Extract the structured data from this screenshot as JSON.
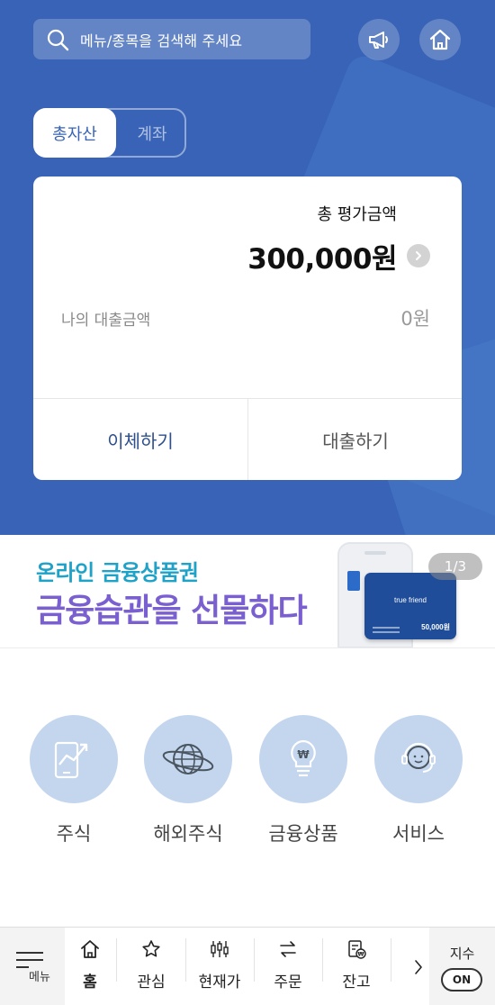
{
  "header": {
    "search": {
      "placeholder": "메뉴/종목을 검색해 주세요"
    },
    "segments": {
      "active": "총자산",
      "inactive": "계좌"
    }
  },
  "summary_card": {
    "total_label": "총 평가금액",
    "total_amount": "300,000원",
    "loan_label": "나의 대출금액",
    "loan_amount": "0원",
    "actions": {
      "transfer": "이체하기",
      "loan": "대출하기"
    }
  },
  "banner": {
    "line1": "온라인 금융상품권",
    "line2": "금융습관을 선물하다",
    "card_brand": "true friend",
    "card_price": "50,000원",
    "pager": "1/3"
  },
  "quick_menu": [
    {
      "label": "주식",
      "icon": "stock-chart-icon"
    },
    {
      "label": "해외주식",
      "icon": "globe-icon"
    },
    {
      "label": "금융상품",
      "icon": "lightbulb-won-icon"
    },
    {
      "label": "서비스",
      "icon": "headset-icon"
    }
  ],
  "bottom_nav": {
    "menu_label": "메뉴",
    "tabs": [
      {
        "label": "홈",
        "icon": "home-icon",
        "active": true
      },
      {
        "label": "관심",
        "icon": "star-icon"
      },
      {
        "label": "현재가",
        "icon": "candlestick-icon"
      },
      {
        "label": "주문",
        "icon": "exchange-icon"
      },
      {
        "label": "잔고",
        "icon": "balance-icon"
      }
    ],
    "index_label": "지수",
    "index_toggle": "ON"
  },
  "colors": {
    "header_bg": "#3863b6",
    "accent_text": "#2d4f8e",
    "quick_circle": "#c3d6ee",
    "banner_line1": "#1fa2c8",
    "banner_line2": "#7a5fd0"
  }
}
